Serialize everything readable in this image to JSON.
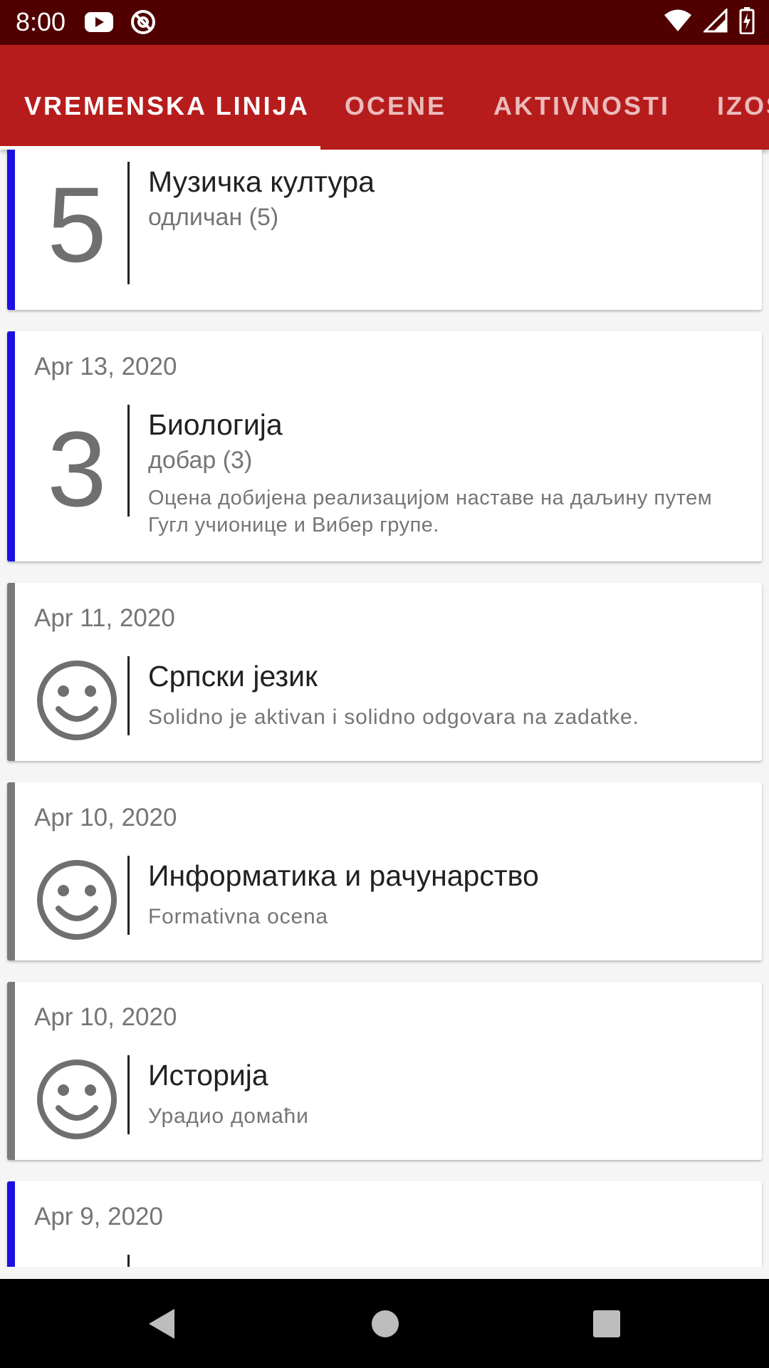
{
  "status_bar": {
    "time": "8:00"
  },
  "tabs": [
    "VREMENSKA LINIJA",
    "OCENE",
    "AKTIVNOSTI",
    "IZOSTANCI"
  ],
  "colors": {
    "grade_accent": "#1a12e0",
    "activity_accent": "#7a7a7a",
    "tab_bar": "#b71c1c",
    "status_bar": "#510000"
  },
  "cards": [
    {
      "kind": "grade",
      "date": "",
      "grade": "5",
      "subject": "Музичка култура",
      "sub": "одличан (5)",
      "note": ""
    },
    {
      "kind": "grade",
      "date": "Apr 13, 2020",
      "grade": "3",
      "subject": "Биологија",
      "sub": "добар (3)",
      "note": "Оцена добијена реализацијом наставе на даљину путем Гугл учионице и Вибер групе."
    },
    {
      "kind": "activity",
      "date": "Apr 11, 2020",
      "icon": "smiley-icon",
      "subject": "Српски језик",
      "sub": "Solidno je aktivan i solidno odgovara na zadatke.",
      "note": ""
    },
    {
      "kind": "activity",
      "date": "Apr 10, 2020",
      "icon": "smiley-icon",
      "subject": "Информатика и рачунарство",
      "sub": "Formativna ocena",
      "note": ""
    },
    {
      "kind": "activity",
      "date": "Apr 10, 2020",
      "icon": "smiley-icon",
      "subject": "Историја",
      "sub": "Урадио домаћи",
      "note": ""
    },
    {
      "kind": "grade",
      "date": "Apr 9, 2020",
      "grade": "",
      "subject": "",
      "sub": "",
      "note": ""
    }
  ]
}
